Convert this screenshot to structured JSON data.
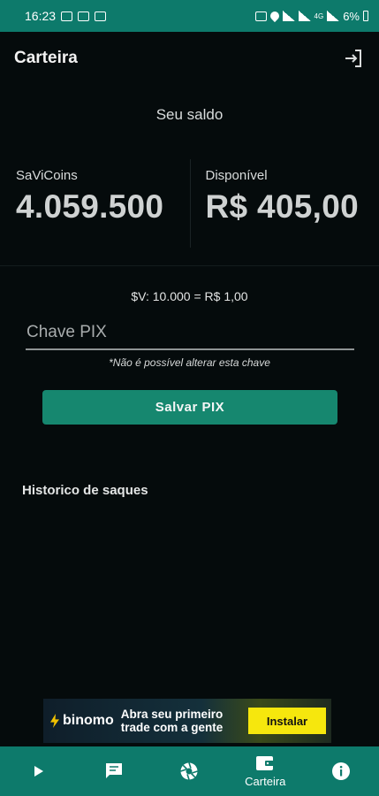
{
  "status_bar": {
    "time": "16:23",
    "network_4g": "4G",
    "battery": "6%"
  },
  "app_bar": {
    "title": "Carteira",
    "logout_icon": "logout-icon"
  },
  "balance": {
    "heading": "Seu saldo",
    "savicoins_label": "SaViCoins",
    "savicoins_value": "4.059.500",
    "available_label": "Disponível",
    "available_value": "R$ 405,00"
  },
  "rate": "$V: 10.000 = R$ 1,00",
  "pix": {
    "placeholder": "Chave PIX",
    "value": "",
    "note": "*Não é possível alterar esta chave",
    "save_label": "Salvar PIX"
  },
  "history": {
    "title": "Historico de saques"
  },
  "ad": {
    "brand": "binomo",
    "text": "Abra seu primeiro trade com a gente",
    "cta": "Instalar"
  },
  "nav": {
    "items": [
      {
        "icon": "play-icon",
        "label": ""
      },
      {
        "icon": "chat-icon",
        "label": ""
      },
      {
        "icon": "aperture-icon",
        "label": ""
      },
      {
        "icon": "wallet-icon",
        "label": "Carteira"
      },
      {
        "icon": "info-icon",
        "label": ""
      }
    ]
  },
  "colors": {
    "primary": "#0d7a6b",
    "button": "#16876f",
    "background": "#050b0c",
    "ad_cta": "#f6e70d"
  }
}
